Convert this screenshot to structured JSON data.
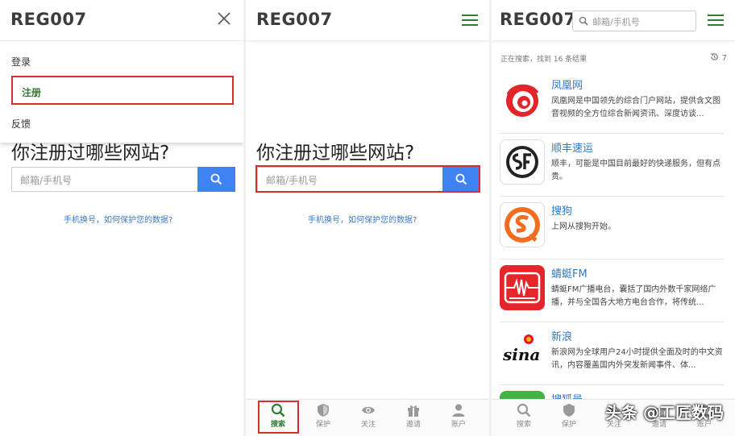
{
  "logo": "REG007",
  "menu": {
    "items": [
      "登录",
      "注册",
      "反馈"
    ]
  },
  "home": {
    "headline": "你注册过哪些网站?",
    "search_placeholder": "邮箱/手机号",
    "link": "手机换号，如何保护您的数据?"
  },
  "tabs": [
    "搜索",
    "保护",
    "关注",
    "邀请",
    "账户"
  ],
  "results_page": {
    "search_placeholder": "邮箱/手机号",
    "status": "正在搜索，找到 16 条结果",
    "count": "7",
    "results": [
      {
        "title": "凤凰网",
        "desc": "凤凰网是中国领先的综合门户网站，提供含文图音视频的全方位综合新闻资讯、深度访谈..."
      },
      {
        "title": "顺丰速运",
        "desc": "顺丰，可能是中国目前最好的快递服务，但有点贵。"
      },
      {
        "title": "搜狗",
        "desc": "上网从搜狗开始。"
      },
      {
        "title": "蜻蜓FM",
        "desc": "蜻蜓FM广播电台，囊括了国内外数千家网络广播，并与全国各大地方电台合作，将传统..."
      },
      {
        "title": "新浪",
        "desc": "新浪网为全球用户24小时提供全面及时的中文资讯，内容覆盖国内外突发新闻事件、体..."
      },
      {
        "title": "搜狐号",
        "desc": ""
      }
    ]
  },
  "watermark": "头条 @工匠数码",
  "colors": {
    "accent_green": "#2e7d32",
    "search_blue": "#3f83f3",
    "highlight_red": "#d32f2f",
    "link_blue": "#3a78c4"
  }
}
